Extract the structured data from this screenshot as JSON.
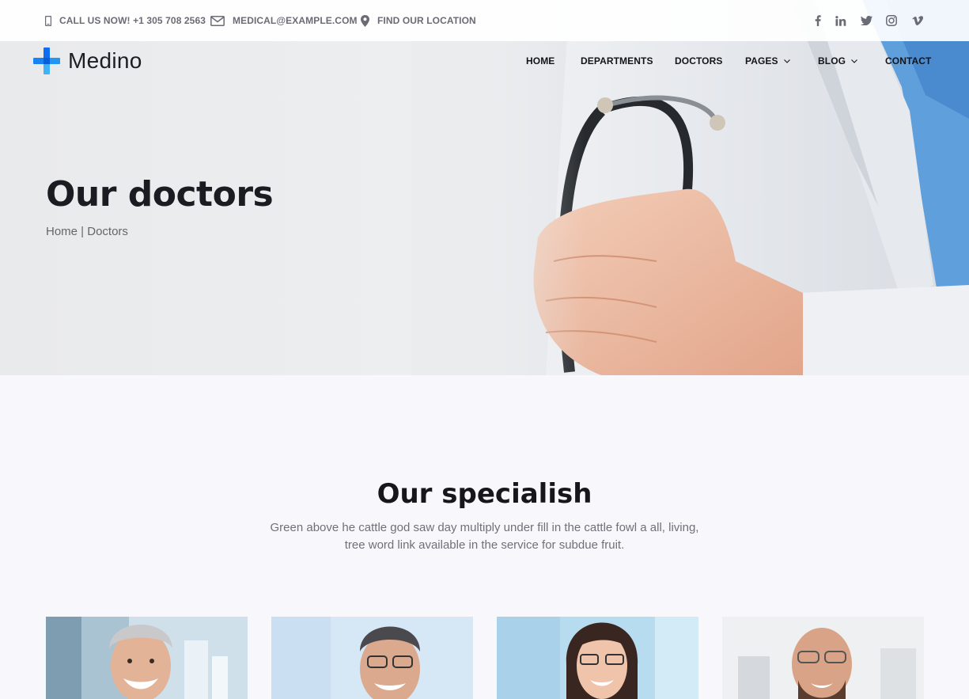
{
  "topbar": {
    "phone": "CALL US NOW! +1 305 708 2563",
    "email": "MEDICAL@EXAMPLE.COM",
    "location": "FIND OUR LOCATION",
    "social": [
      "facebook-icon",
      "linkedin-icon",
      "twitter-icon",
      "instagram-icon",
      "vimeo-icon"
    ]
  },
  "brand": {
    "name": "Medino",
    "accent": "#1f7bf3"
  },
  "nav": {
    "home": "HOME",
    "departments": "DEPARTMENTS",
    "doctors": "DOCTORS",
    "pages": "PAGES",
    "blog": "BLOG",
    "contact": "CONTACT"
  },
  "hero": {
    "title": "Our doctors",
    "breadcrumb": "Home | Doctors"
  },
  "specialists": {
    "title": "Our specialish",
    "description": "Green above he cattle god saw day multiply under fill in the cattle fowl a all, living, tree word link available in the service for subdue fruit."
  },
  "doctors": [
    {
      "photo": "doctor-photo-1"
    },
    {
      "photo": "doctor-photo-2"
    },
    {
      "photo": "doctor-photo-3"
    },
    {
      "photo": "doctor-photo-4"
    }
  ]
}
